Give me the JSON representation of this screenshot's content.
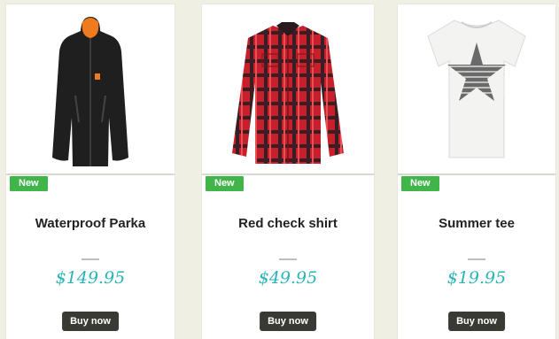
{
  "products": [
    {
      "badge": "New",
      "name": "Waterproof Parka",
      "price": "$149.95",
      "button": "Buy now",
      "image": "black-parka-jacket-image"
    },
    {
      "badge": "New",
      "name": "Red check shirt",
      "price": "$49.95",
      "button": "Buy now",
      "image": "red-check-shirt-image"
    },
    {
      "badge": "New",
      "name": "Summer tee",
      "price": "$19.95",
      "button": "Buy now",
      "image": "white-tshirt-image"
    }
  ],
  "colors": {
    "background": "#efefe4",
    "badge": "#3fb54a",
    "price": "#2ab4b8",
    "button": "#3a3a34"
  }
}
